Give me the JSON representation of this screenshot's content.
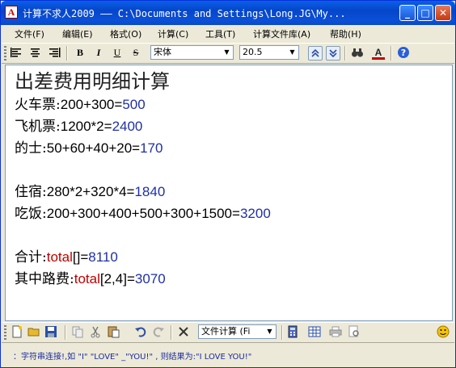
{
  "window": {
    "title": "计算不求人2009 —— C:\\Documents and Settings\\Long.JG\\My...",
    "app_icon_glyph": "A",
    "minimize_glyph": "_",
    "maximize_glyph": "□",
    "close_glyph": "✕"
  },
  "menu": [
    "文件(F)",
    "编辑(E)",
    "格式(O)",
    "计算(C)",
    "工具(T)",
    "计算文件库(A)",
    "帮助(H)"
  ],
  "format_toolbar": {
    "bold": "B",
    "italic": "I",
    "underline": "U",
    "strike": "S",
    "font_name": "宋体",
    "font_size": "20.5",
    "font_color_glyph": "A",
    "accent_color": "#c00000"
  },
  "editor": {
    "heading": "出差费用明细计算",
    "lines": [
      {
        "label": "火车票:",
        "expr": "200+300=",
        "result": "500"
      },
      {
        "label": "飞机票:",
        "expr": "1200*2=",
        "result": "2400"
      },
      {
        "label": "的士:",
        "expr": "50+60+40+20=",
        "result": "170"
      },
      {
        "label": "住宿:",
        "expr": "280*2+320*4=",
        "result": "1840"
      },
      {
        "label": "吃饭:",
        "expr": "200+300+400+500+300+1500=",
        "result": "3200"
      }
    ],
    "total_line": {
      "label": "合计:",
      "func": "total",
      "args": "[]=",
      "result": "8110"
    },
    "partial_line": {
      "label": "其中路费:",
      "func": "total",
      "args": "[2,4]=",
      "result": "3070"
    },
    "colors": {
      "result": "#1f2fa8",
      "function": "#c00000"
    }
  },
  "bottom_toolbar": {
    "mode_select": "文件计算 (Fi"
  },
  "status": {
    "tip": "：字符串连接!,如 \"I\" \"LOVE\" _\"YOU!\" , 则结果为:\"I LOVE YOU!\""
  }
}
